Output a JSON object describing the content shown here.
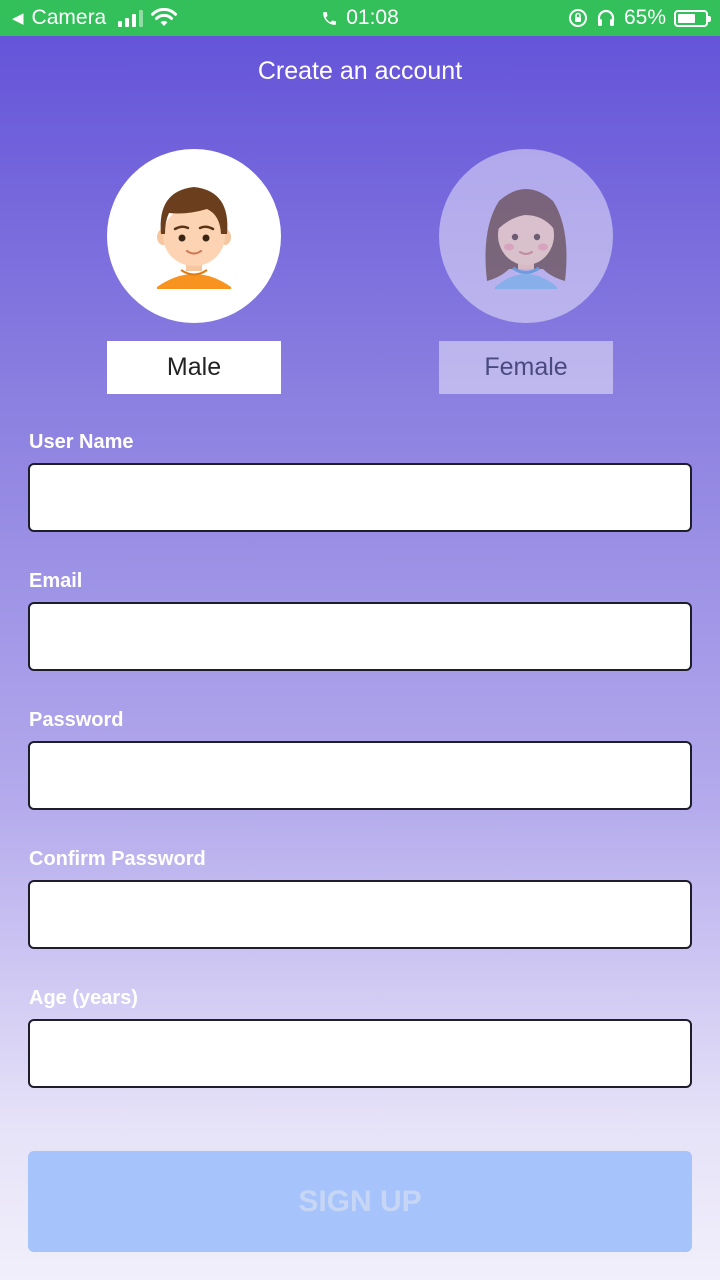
{
  "status_bar": {
    "back_app": "Camera",
    "time": "01:08",
    "battery": "65%",
    "battery_level": 0.65,
    "signal_bars": 3
  },
  "page": {
    "title": "Create an account"
  },
  "gender": {
    "male_label": "Male",
    "female_label": "Female",
    "selected": "male"
  },
  "form": {
    "username_label": "User Name",
    "email_label": "Email",
    "password_label": "Password",
    "confirm_password_label": "Confirm Password",
    "age_label": "Age (years)",
    "username_value": "",
    "email_value": "",
    "password_value": "",
    "confirm_password_value": "",
    "age_value": ""
  },
  "actions": {
    "signup_label": "SIGN UP"
  },
  "colors": {
    "status_bar": "#33c05a",
    "gradient_top": "#6150d8",
    "gradient_bottom": "#f1effb",
    "signup_bg": "#a6c3fb"
  }
}
